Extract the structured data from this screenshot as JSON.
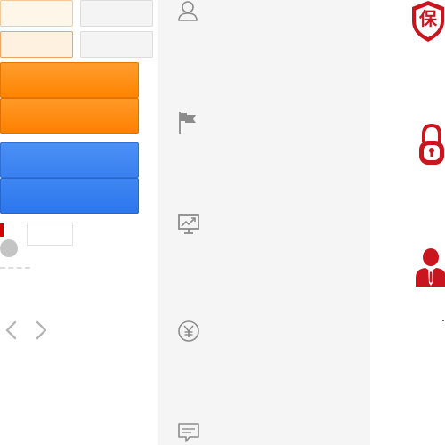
{
  "sprite_left": {
    "buttons": [
      {
        "name": "button-light-normal",
        "label": ""
      },
      {
        "name": "button-gray-normal",
        "label": ""
      },
      {
        "name": "button-light-hover",
        "label": ""
      },
      {
        "name": "button-gray-hover",
        "label": ""
      },
      {
        "name": "button-orange-normal",
        "label": ""
      },
      {
        "name": "button-orange-hover",
        "label": ""
      },
      {
        "name": "button-blue-normal",
        "label": ""
      },
      {
        "name": "button-blue-hover",
        "label": ""
      }
    ],
    "arrows": {
      "prev_icon": "chevron-left-icon",
      "next_icon": "chevron-right-icon"
    }
  },
  "panel": {
    "icons": [
      "user-icon",
      "flag-icon",
      "monitor-chart-icon",
      "yen-circle-icon",
      "comment-icon"
    ]
  },
  "right_icons": {
    "shield_text": "保",
    "icons": [
      "shield-guarantee-icon",
      "padlock-icon",
      "user-tie-icon"
    ],
    "accent_color": "#c9151e"
  },
  "colors": {
    "orange": "#ff8a10",
    "blue": "#3a80f0",
    "panel_bg": "#f5f5f5",
    "icon_gray": "#8c8c8c"
  }
}
